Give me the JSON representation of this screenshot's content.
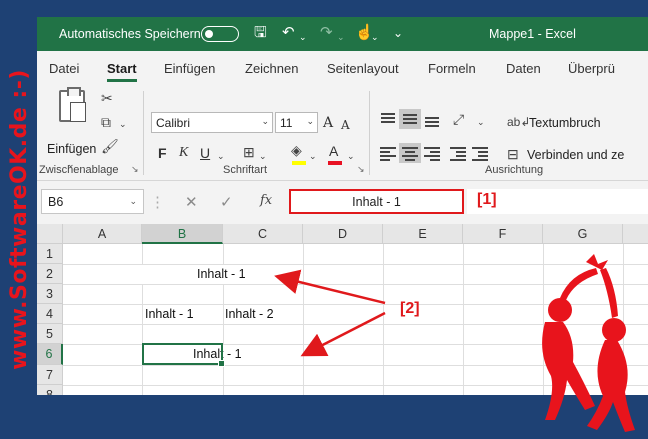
{
  "watermark": "www.SoftwareOK.de :-)",
  "titlebar": {
    "autosave_label": "Automatisches Speichern",
    "document_title": "Mappe1  -  Excel"
  },
  "menu": {
    "tabs": [
      "Datei",
      "Start",
      "Einfügen",
      "Zeichnen",
      "Seitenlayout",
      "Formeln",
      "Daten",
      "Überprü"
    ]
  },
  "ribbon": {
    "clipboard": {
      "paste_label": "Einfügen",
      "group_label": "Zwischenablage"
    },
    "font": {
      "font_name": "Calibri",
      "font_size": "11",
      "group_label": "Schriftart",
      "bold": "F",
      "italic": "K",
      "underline": "U",
      "grow": "A",
      "shrink": "A"
    },
    "alignment": {
      "wrap_label": "Textumbruch",
      "merge_label": "Verbinden und ze",
      "group_label": "Ausrichtung"
    }
  },
  "formula_bar": {
    "name_box": "B6",
    "fx": "fx",
    "content": "Inhalt - 1",
    "annotation": "[1]"
  },
  "grid": {
    "columns": [
      "A",
      "B",
      "C",
      "D",
      "E",
      "F",
      "G"
    ],
    "selected_column": "B",
    "rows": [
      "1",
      "2",
      "3",
      "4",
      "5",
      "6",
      "7",
      "8"
    ],
    "selected_row": "6",
    "cells": {
      "B2": "Inhalt - 1",
      "B4": "Inhalt - 1",
      "C4": "Inhalt - 2",
      "B6": "Inhalt - 1"
    }
  },
  "annotation2": "[2]",
  "colors": {
    "excel_green": "#217346",
    "annotation_red": "#e0191c",
    "frame_blue": "#1e4174"
  }
}
